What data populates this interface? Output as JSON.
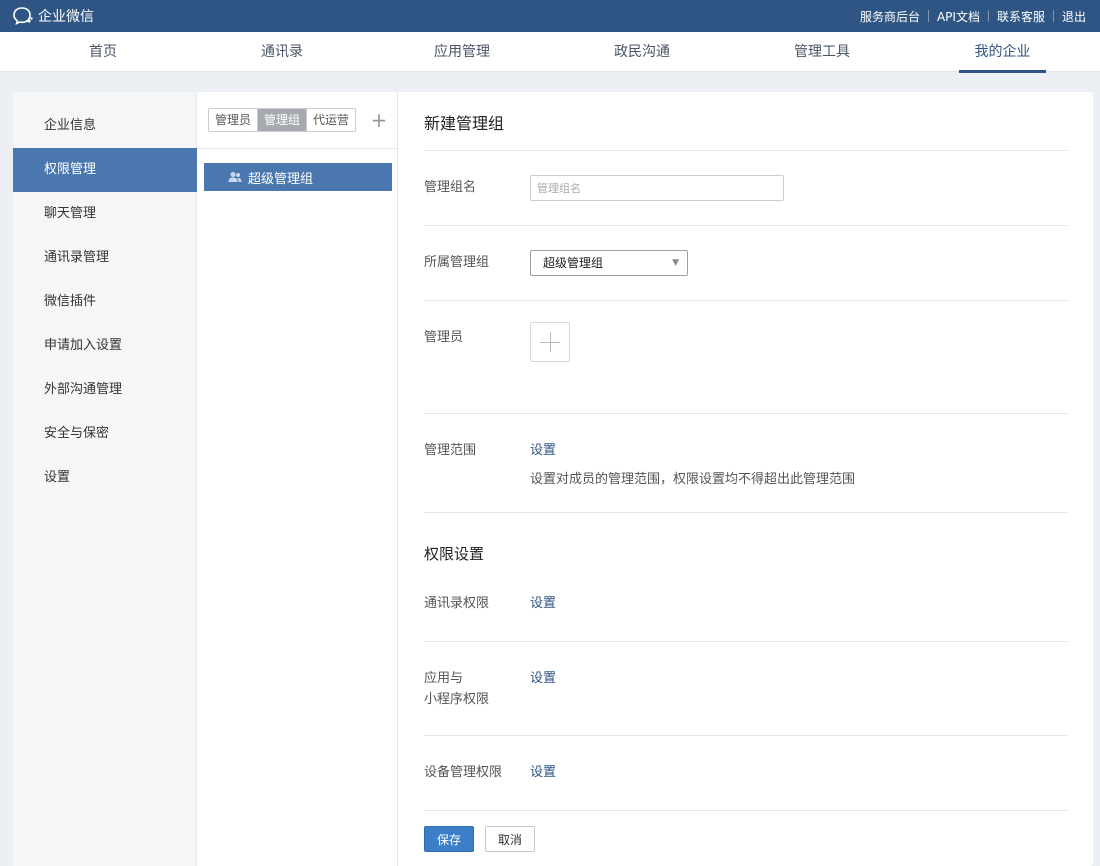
{
  "header": {
    "app_name": "企业微信",
    "links": [
      "服务商后台",
      "API文档",
      "联系客服",
      "退出"
    ],
    "brand_color": "#2f5584"
  },
  "nav": {
    "tabs": [
      "首页",
      "通讯录",
      "应用管理",
      "政民沟通",
      "管理工具",
      "我的企业"
    ],
    "active": "我的企业"
  },
  "sidebar": {
    "items": [
      "企业信息",
      "权限管理",
      "聊天管理",
      "通讯录管理",
      "微信插件",
      "申请加入设置",
      "外部沟通管理",
      "安全与保密",
      "设置"
    ],
    "active": "权限管理"
  },
  "middle": {
    "segments": [
      "管理员",
      "管理组",
      "代运营"
    ],
    "active_segment": "管理组",
    "groups": [
      "超级管理组"
    ]
  },
  "form": {
    "title": "新建管理组",
    "group_name_label": "管理组名",
    "group_name_placeholder": "管理组名",
    "group_name_value": "",
    "parent_label": "所属管理组",
    "parent_value": "超级管理组",
    "admin_label": "管理员",
    "scope_label": "管理范围",
    "scope_link": "设置",
    "scope_desc": "设置对成员的管理范围，权限设置均不得超出此管理范围",
    "perm_title": "权限设置",
    "contacts_perm_label": "通讯录权限",
    "contacts_perm_link": "设置",
    "app_perm_label_1": "应用与",
    "app_perm_label_2": "小程序权限",
    "app_perm_link": "设置",
    "device_perm_label": "设备管理权限",
    "device_perm_link": "设置",
    "save_label": "保存",
    "cancel_label": "取消"
  }
}
